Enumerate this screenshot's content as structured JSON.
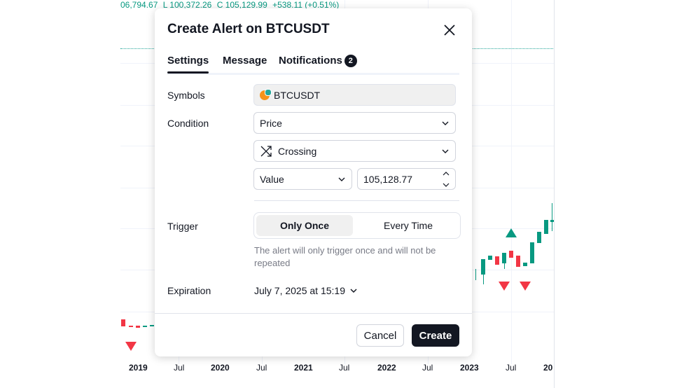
{
  "chart": {
    "ohlc": {
      "open": "06,794.67",
      "low": "L 100,372.26",
      "close": "C 105,129.99",
      "change": "+538.11 (+0.51%)"
    },
    "x_axis": [
      "2019",
      "Jul",
      "2020",
      "Jul",
      "2021",
      "Jul",
      "2022",
      "Jul",
      "2023",
      "Jul",
      "20"
    ],
    "colors": {
      "up": "#089981",
      "down": "#f23645"
    }
  },
  "dialog": {
    "title": "Create Alert on BTCUSDT",
    "tabs": [
      {
        "label": "Settings"
      },
      {
        "label": "Message"
      },
      {
        "label": "Notifications",
        "badge": "2"
      }
    ],
    "symbols_label": "Symbols",
    "symbol_value": "BTCUSDT",
    "condition_label": "Condition",
    "condition_source": "Price",
    "condition_operator": "Crossing",
    "value_type": "Value",
    "value_amount": "105,128.77",
    "trigger_label": "Trigger",
    "trigger_options": [
      "Only Once",
      "Every Time"
    ],
    "trigger_selected": "Only Once",
    "trigger_hint": "The alert will only trigger once and will not be repeated",
    "expiration_label": "Expiration",
    "expiration_value": "July 7, 2025 at 15:19",
    "cancel_label": "Cancel",
    "create_label": "Create"
  }
}
